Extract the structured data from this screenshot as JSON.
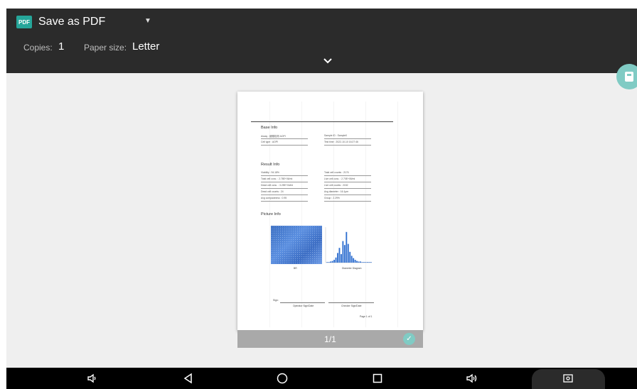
{
  "header": {
    "pdf_badge": "PDF",
    "destination": "Save as PDF",
    "copies_label": "Copies:",
    "copies_value": "1",
    "paper_label": "Paper size:",
    "paper_value": "Letter"
  },
  "preview": {
    "sections": {
      "base": "Base Info",
      "result": "Result Info",
      "picture": "Picture Info"
    },
    "base_fields": [
      "Assay : 细胞检测 AOPI",
      "Sample ID : Sample0",
      "Cell type : AOPI",
      "Test time : 2022-10-10 16:27:46"
    ],
    "result_fields": [
      "Viability : 94.18%",
      "Total cell counts : 2176",
      "Total cell conc. : 2.78E+06/ml",
      "Live cell conc. : 2.70E+06/ml",
      "Dead cell conc. : 3.25E+04/ml",
      "Live cell counts : 2152",
      "Dead cell counts : 24",
      "Avg diameter : 16.1μm",
      "Avg compactness : 0.95",
      "Group : 2.29%"
    ],
    "image_caption": "BR",
    "chart_caption": "Diameter Diagram",
    "sign_label": "Sign:",
    "operator_caption": "Operator Sign/Date",
    "checker_caption": "Checker Sign/Date",
    "page_footer": "Page 1 of 1",
    "page_indicator": "1/1"
  },
  "chart_data": {
    "type": "bar",
    "title": "",
    "values": [
      1,
      1,
      2,
      3,
      5,
      9,
      17,
      26,
      15,
      38,
      31,
      54,
      33,
      19,
      12,
      8,
      5,
      3,
      2,
      2,
      1,
      1,
      1,
      1,
      1,
      1
    ],
    "ylim": [
      0,
      60
    ]
  },
  "colors": {
    "topbar": "#2b2b2b",
    "accent": "#80cbc4",
    "pdf_icon": "#26a69a",
    "chart_bars": "#2f6fd0"
  },
  "icons": {
    "header": [
      "pdf-icon",
      "dropdown-caret-icon",
      "expand-chevron-icon"
    ],
    "fab": "save-pdf-icon",
    "nav": [
      "volume-down-icon",
      "back-icon",
      "home-icon",
      "recents-icon",
      "volume-up-icon",
      "screenshot-icon"
    ]
  }
}
